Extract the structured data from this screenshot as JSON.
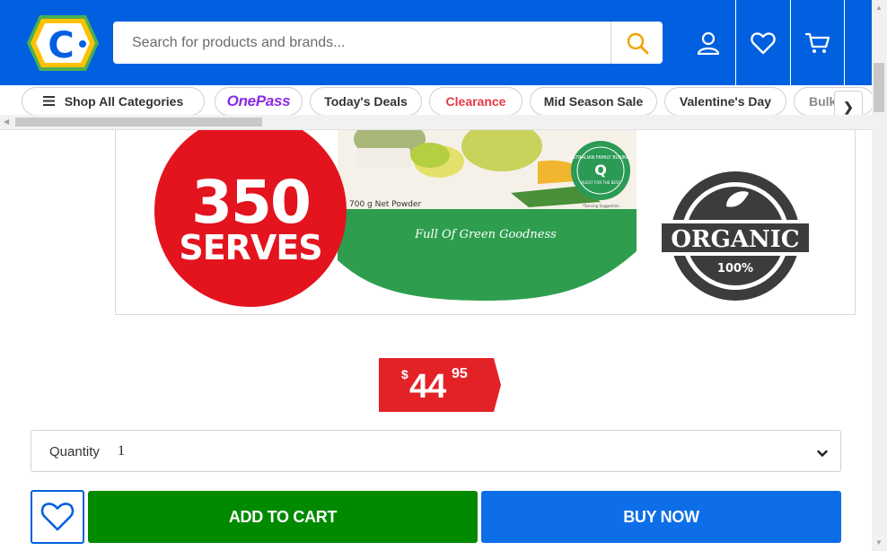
{
  "header": {
    "logo_text": "C",
    "search": {
      "placeholder": "Search for products and brands..."
    }
  },
  "categories": {
    "items": [
      {
        "label": "Shop All Categories"
      },
      {
        "label": "OnePass"
      },
      {
        "label": "Today's Deals"
      },
      {
        "label": "Clearance"
      },
      {
        "label": "Mid Season Sale"
      },
      {
        "label": "Valentine's Day"
      },
      {
        "label": "Bulk"
      }
    ],
    "next_glyph": "❯"
  },
  "product_image": {
    "badge_number": "350",
    "badge_word": "SERVES",
    "net_weight": "700 g Net Powder",
    "tagline": "Full Of Green Goodness",
    "serving_note": "*Serving Suggestion",
    "seal_text": "AUSTRALIAN FAMILY BUSINESS",
    "seal_inner": "QUEST FOR THE BEST",
    "organic_word": "ORGANIC",
    "organic_percent": "100%"
  },
  "price": {
    "currency": "$",
    "dollars": "44",
    "cents": "95"
  },
  "quantity": {
    "label": "Quantity",
    "value": "1"
  },
  "actions": {
    "add_to_cart": "ADD TO CART",
    "buy_now": "BUY NOW"
  },
  "colors": {
    "header_blue": "#0060df",
    "price_red": "#e32228",
    "add_green": "#008a00",
    "buy_blue": "#0d6ee8",
    "onepass_purple": "#8a2be2",
    "clearance_red": "#e63946"
  },
  "icons": [
    "catch-logo-icon",
    "search-icon",
    "account-icon",
    "heart-icon",
    "cart-icon",
    "menu-icon",
    "chevron-down-icon",
    "chevron-right-icon"
  ]
}
